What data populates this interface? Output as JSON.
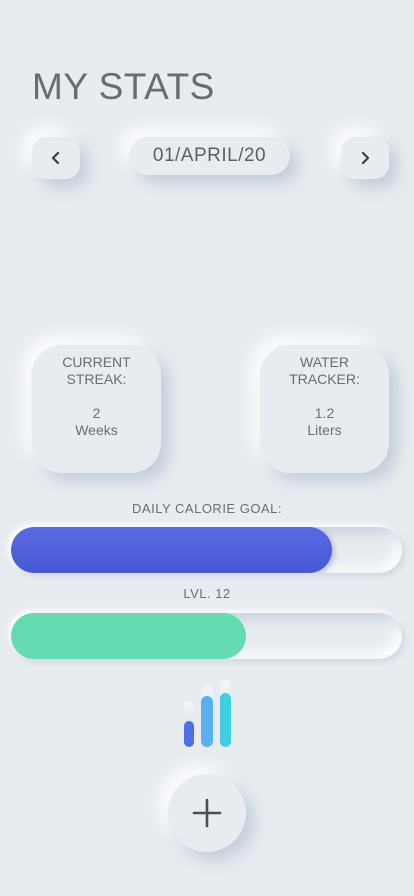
{
  "header": {
    "title": "MY STATS"
  },
  "date_nav": {
    "prev_icon": "chevron-left-icon",
    "next_icon": "chevron-right-icon",
    "date": "01/APRIL/20"
  },
  "stats": {
    "streak": {
      "label": "CURRENT STREAK:",
      "value": "2",
      "unit": "Weeks"
    },
    "water": {
      "label": "WATER TRACKER:",
      "value": "1.2",
      "unit": "Liters"
    }
  },
  "progress": {
    "calorie": {
      "label": "DAILY CALORIE GOAL:",
      "fraction": 0.82,
      "color": "#4F5FDC"
    },
    "level": {
      "label": "LVL. 12",
      "fraction": 0.6,
      "color": "#65DBB2"
    }
  },
  "icons": {
    "chart": "bar-chart-icon",
    "add": "plus-icon"
  },
  "colors": {
    "background": "#E8ECF0",
    "chart_bar_1": "#4F6EE8",
    "chart_bar_2": "#5AB0F0",
    "chart_bar_3": "#3FD0E0"
  }
}
